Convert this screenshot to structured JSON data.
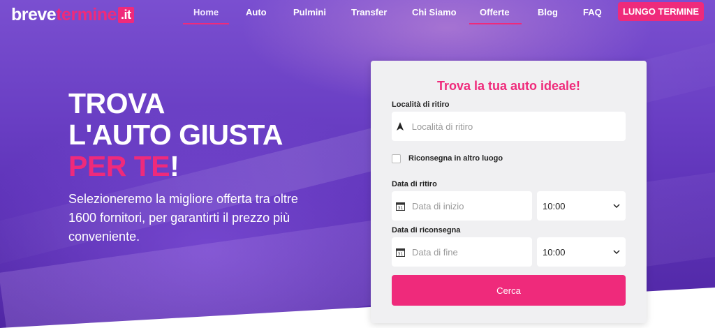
{
  "brand": {
    "part1": "breve",
    "part2": "termine",
    "tld": ".it",
    "accent": "#ef2a7b"
  },
  "nav": {
    "items": [
      {
        "label": "Home",
        "active": true
      },
      {
        "label": "Auto"
      },
      {
        "label": "Pulmini"
      },
      {
        "label": "Transfer"
      },
      {
        "label": "Chi Siamo"
      },
      {
        "label": "Offerte",
        "underlined": true
      },
      {
        "label": "Blog"
      },
      {
        "label": "FAQ"
      }
    ],
    "cta": "LUNGO TERMINE"
  },
  "hero": {
    "line1": "TROVA",
    "line2": "L'AUTO GIUSTA",
    "line3_highlight": "PER TE",
    "line3_end": "!",
    "subtitle": "Selezioneremo la migliore offerta tra oltre 1600 fornitori, per garantirti il prezzo più conveniente."
  },
  "form": {
    "title": "Trova la tua auto ideale!",
    "pickup_location_label": "Località di ritiro",
    "pickup_location_placeholder": "Località di ritiro",
    "return_other_label": "Riconsegna in altro luogo",
    "pickup_date_label": "Data di ritiro",
    "pickup_date_placeholder": "Data di inizio",
    "pickup_time": "10:00",
    "return_date_label": "Data di riconsegna",
    "return_date_placeholder": "Data di fine",
    "return_time": "10:00",
    "submit": "Cerca"
  }
}
